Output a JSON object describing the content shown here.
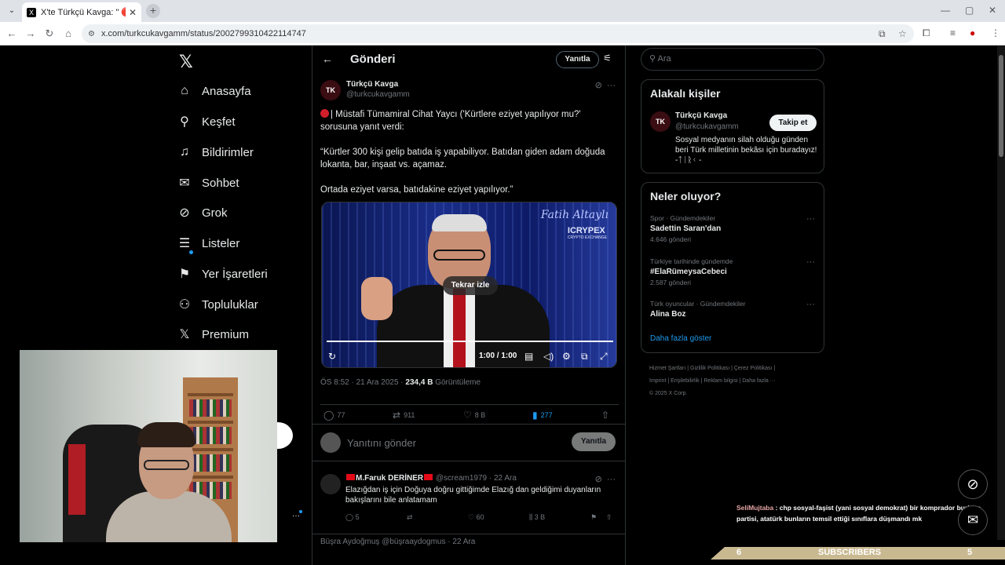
{
  "browser": {
    "tab_title": "X'te Türkçü Kavga: \" 🔴 | Müstafi",
    "url": "x.com/turkcukavgamm/status/2002799310422114747"
  },
  "nav": {
    "items": [
      {
        "label": "Anasayfa",
        "icon": "home-icon"
      },
      {
        "label": "Keşfet",
        "icon": "search-icon"
      },
      {
        "label": "Bildirimler",
        "icon": "bell-icon"
      },
      {
        "label": "Sohbet",
        "icon": "mail-icon"
      },
      {
        "label": "Grok",
        "icon": "grok-icon"
      },
      {
        "label": "Listeler",
        "icon": "list-icon"
      },
      {
        "label": "Yer İşaretleri",
        "icon": "bookmark-icon"
      },
      {
        "label": "Topluluklar",
        "icon": "people-icon"
      },
      {
        "label": "Premium",
        "icon": "x-logo-icon"
      }
    ]
  },
  "header": {
    "title": "Gönderi",
    "reply_button": "Yanıtla"
  },
  "tweet": {
    "author_name": "Türkçü Kavga",
    "author_handle": "@turkcukavgamm",
    "avatar_text": "TK",
    "text_1": "| Müstafi Tümamiral Cihat Yaycı ('Kürtlere eziyet yapılıyor mu?' sorusuna yanıt verdi:",
    "text_2": "“Kürtler 300 kişi gelip batıda iş yapabiliyor. Batıdan giden adam doğuda lokanta, bar, inşaat vs. açamaz.",
    "text_3": "Ortada eziyet varsa, batıdakine eziyet yapılıyor.”",
    "video": {
      "brand": "Fatih Altaylı",
      "sponsor": "ICRYPEX",
      "sponsor_sub": "CRYPTO EXCHANGE",
      "replay_label": "Tekrar izle",
      "time": "1:00 / 1:00"
    },
    "timestamp": "ÖS 8:52 · 21 Ara 2025 · ",
    "views_value": "234,4 B",
    "views_label": " Görüntüleme",
    "stats": {
      "replies": "77",
      "reposts": "911",
      "likes": "8 B",
      "bookmarks": "277"
    }
  },
  "reply_composer": {
    "placeholder": "Yanıtını gönder",
    "button": "Yanıtla"
  },
  "comment": {
    "name": "M.Faruk DERİNER",
    "handle": "@scream1979 · 22 Ara",
    "text": "Elazığdan iş için Doğuya doğru gittiğimde Elazığ dan geldiğimi duyanların bakışlarını bile anlatamam",
    "replies": "5",
    "likes": "60",
    "views": "3 B"
  },
  "next_comment_partial": "Büşra Aydoğmuş @büşraaydogmus · 22 Ara",
  "right": {
    "search_placeholder": "Ara",
    "relevant_title": "Alakalı kişiler",
    "person": {
      "name": "Türkçü Kavga",
      "handle": "@turkcukavgamm",
      "follow": "Takip et",
      "bio": "Sosyal medyanın silah olduğu günden beri Türk milletinin bekâsı için buradayız! -ᛏᛁᚱᚲ -"
    },
    "trends_title": "Neler oluyor?",
    "trends": [
      {
        "category": "Spor · Gündemdekiler",
        "name": "Sadettin Saran'dan",
        "count": "4.646 gönderi"
      },
      {
        "category": "Türkiye tarihinde gündemde",
        "name": "#ElaRümeysaCebeci",
        "count": "2.587 gönderi"
      },
      {
        "category": "Türk oyuncular · Gündemdekiler",
        "name": "Alina Boz",
        "count": ""
      }
    ],
    "show_more": "Daha fazla göster",
    "footer_1": "Hizmet Şartları  |  Gizlilik Politikası  |  Çerez Politikası  |",
    "footer_2": "Imprint  |  Erişilebilirlik  |  Reklam bilgisi  |  Daha fazla ···",
    "footer_3": "© 2025 X Corp."
  },
  "overlay": {
    "chat_user": "SeliMujtaba",
    "chat_text": " : chp sosyal-faşist (yani sosyal demokrat) bir komprador burjuva partisi, atatürk bunların temsil ettiği sınıflara düşmandı mk",
    "subs_left": "6",
    "subs_label": "SUBSCRIBERS",
    "subs_right": "5"
  }
}
